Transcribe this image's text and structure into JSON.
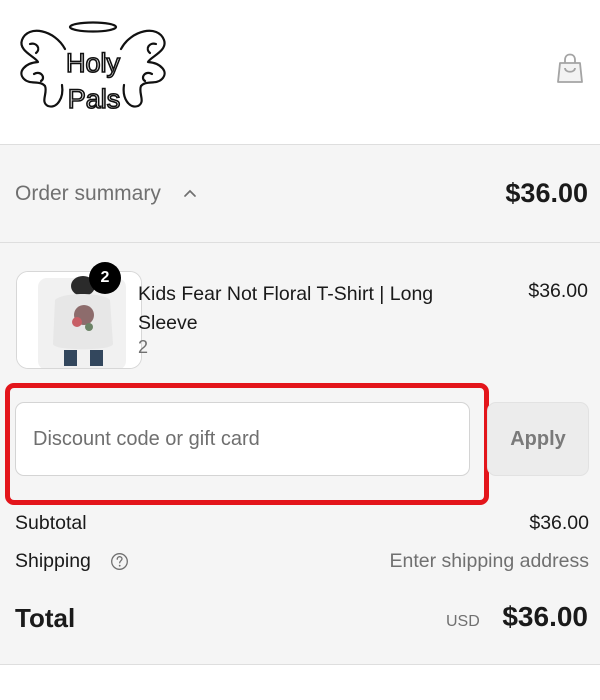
{
  "brand": {
    "logo_line1": "Holy",
    "logo_line2": "Pals"
  },
  "header": {
    "cart_icon": "shopping-bag-icon"
  },
  "summary": {
    "toggle_label": "Order summary",
    "toggle_icon": "chevron-up-icon",
    "total": "$36.00"
  },
  "product": {
    "name": "Kids Fear Not Floral T-Shirt | Long Sleeve",
    "variant": "2",
    "quantity_badge": "2",
    "price": "$36.00"
  },
  "discount": {
    "placeholder": "Discount code or gift card",
    "value": "",
    "apply_label": "Apply"
  },
  "costs": {
    "subtotal_label": "Subtotal",
    "subtotal_value": "$36.00",
    "shipping_label": "Shipping",
    "shipping_value": "Enter shipping address",
    "total_label": "Total",
    "total_currency": "USD",
    "total_value": "$36.00"
  },
  "colors": {
    "highlight": "#e3151b",
    "summary_bg": "#f5f5f5",
    "muted_text": "#707070"
  }
}
